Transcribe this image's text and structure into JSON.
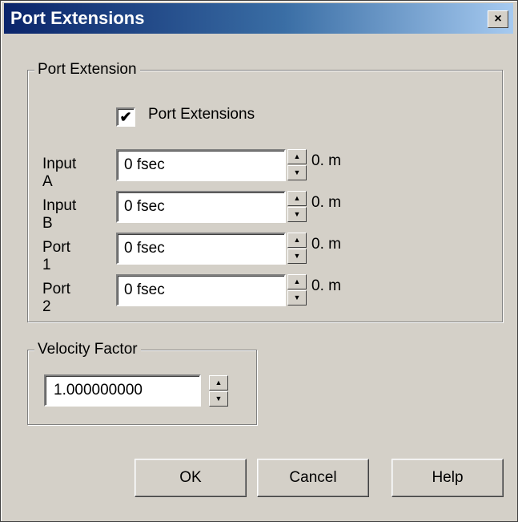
{
  "window": {
    "title": "Port Extensions",
    "close_glyph": "×"
  },
  "port_extension_group": {
    "legend": "Port Extension",
    "checkbox": {
      "label": "Port Extensions",
      "checked": true,
      "check_glyph": "✔"
    },
    "rows": [
      {
        "label": "Input A",
        "value": "0 fsec",
        "unit": "0. m"
      },
      {
        "label": "Input B",
        "value": "0 fsec",
        "unit": "0. m"
      },
      {
        "label": "Port 1",
        "value": "0 fsec",
        "unit": "0. m"
      },
      {
        "label": "Port 2",
        "value": "0 fsec",
        "unit": "0. m"
      }
    ]
  },
  "velocity_group": {
    "legend": "Velocity Factor",
    "value": "1.000000000"
  },
  "spinner": {
    "up_icon": "▲",
    "down_icon": "▼"
  },
  "buttons": {
    "ok": "OK",
    "cancel": "Cancel",
    "help": "Help"
  },
  "colors": {
    "title_gradient_start": "#0a246a",
    "title_gradient_end": "#a6caf0",
    "face": "#d4d0c8"
  }
}
